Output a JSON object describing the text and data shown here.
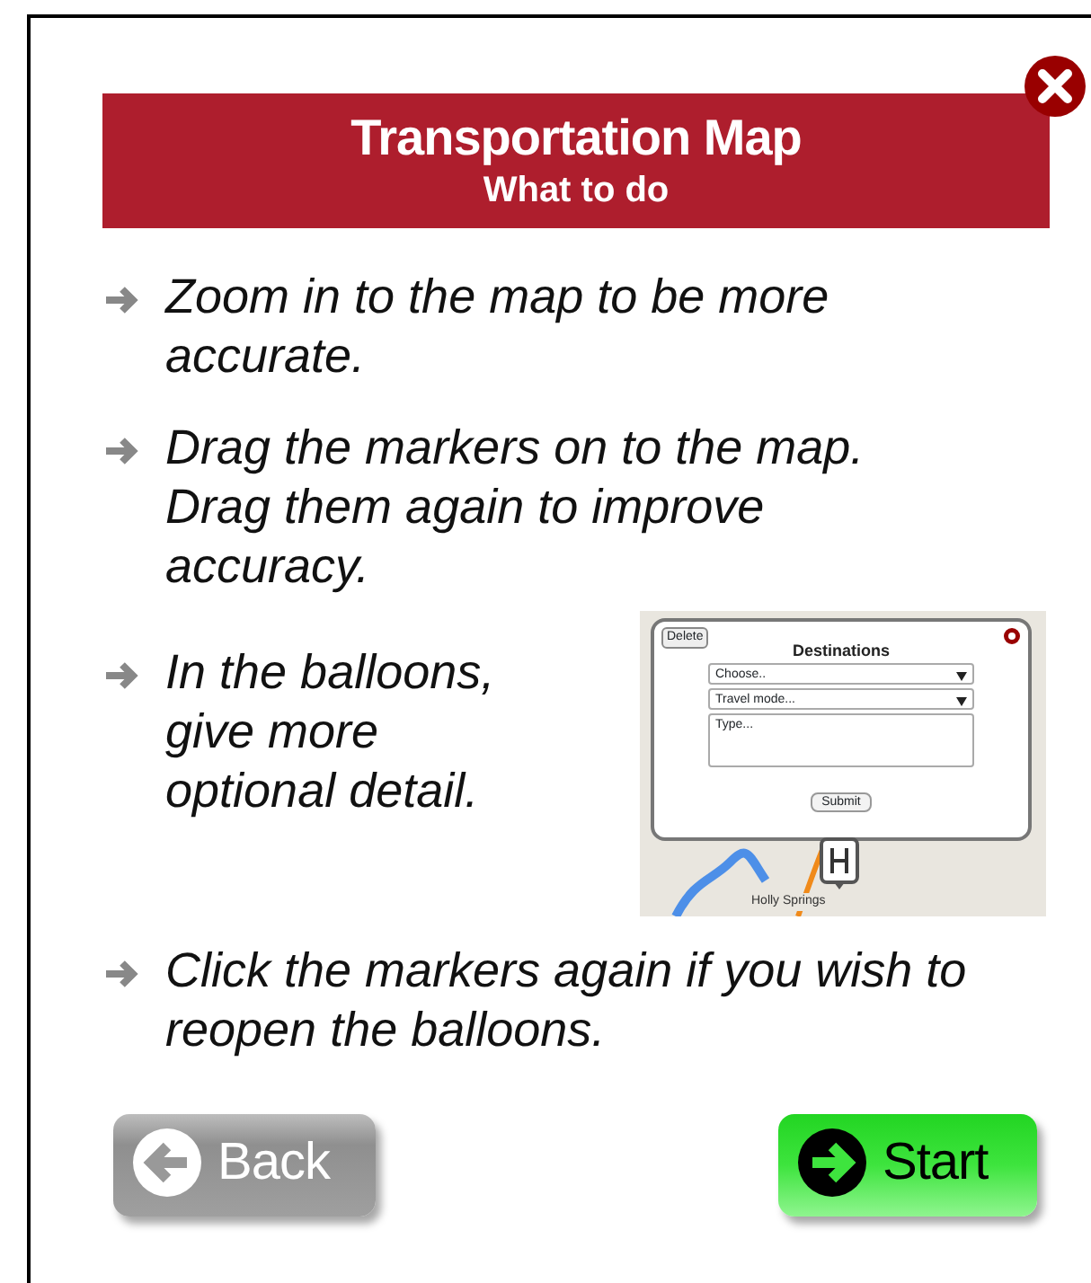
{
  "header": {
    "title": "Transportation Map",
    "subtitle": "What to do"
  },
  "instructions": [
    {
      "text": "Zoom in to the map to be more accurate."
    },
    {
      "text": "Drag the markers on to the map. Drag them again to improve accuracy."
    },
    {
      "text": "In the balloons, give more optional detail."
    },
    {
      "text": "Click the markers again if you wish to reopen the balloons."
    }
  ],
  "inset": {
    "delete_label": "Delete",
    "title": "Destinations",
    "dropdowns": [
      "Choose..",
      "Travel mode..."
    ],
    "textarea_placeholder": "Type...",
    "submit_label": "Submit",
    "map_label": "Holly Springs"
  },
  "buttons": [
    {
      "label": "Back",
      "kind": "back"
    },
    {
      "label": "Start",
      "kind": "start"
    }
  ]
}
